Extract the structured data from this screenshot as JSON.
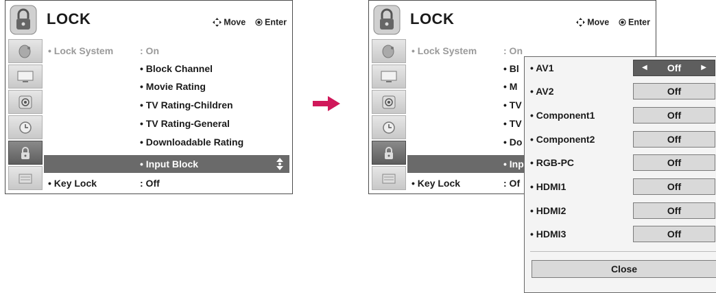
{
  "menu": {
    "title": "LOCK",
    "move_hint": "Move",
    "enter_hint": "Enter",
    "lock_system_label": "Lock System",
    "lock_system_value": ": On",
    "key_lock_label": "Key Lock",
    "key_lock_value": ": Off",
    "items": [
      "Block Channel",
      "Movie Rating",
      "TV Rating-Children",
      "TV Rating-General",
      "Downloadable Rating",
      "Input Block"
    ],
    "right_items_visible": [
      "Bl",
      "M",
      "TV",
      "TV",
      "Do",
      "Inp"
    ],
    "right_lock_value": ": On",
    "right_key_value": ": Of",
    "selected_item": "Input Block"
  },
  "popup": {
    "inputs": [
      {
        "label": "AV1",
        "value": "Off"
      },
      {
        "label": "AV2",
        "value": "Off"
      },
      {
        "label": "Component1",
        "value": "Off"
      },
      {
        "label": "Component2",
        "value": "Off"
      },
      {
        "label": "RGB-PC",
        "value": "Off"
      },
      {
        "label": "HDMI1",
        "value": "Off"
      },
      {
        "label": "HDMI2",
        "value": "Off"
      },
      {
        "label": "HDMI3",
        "value": "Off"
      }
    ],
    "close_label": "Close"
  },
  "colors": {
    "arrow": "#d0185a",
    "selected_bg": "#6a6a6a"
  },
  "icons": [
    "lock-icon",
    "satellite-dish-icon",
    "monitor-icon",
    "speaker-icon",
    "clock-icon",
    "lock-small-icon",
    "option-icon",
    "move-arrows-icon",
    "enter-dot-icon",
    "scroll-updown-icon",
    "right-arrow-icon"
  ]
}
